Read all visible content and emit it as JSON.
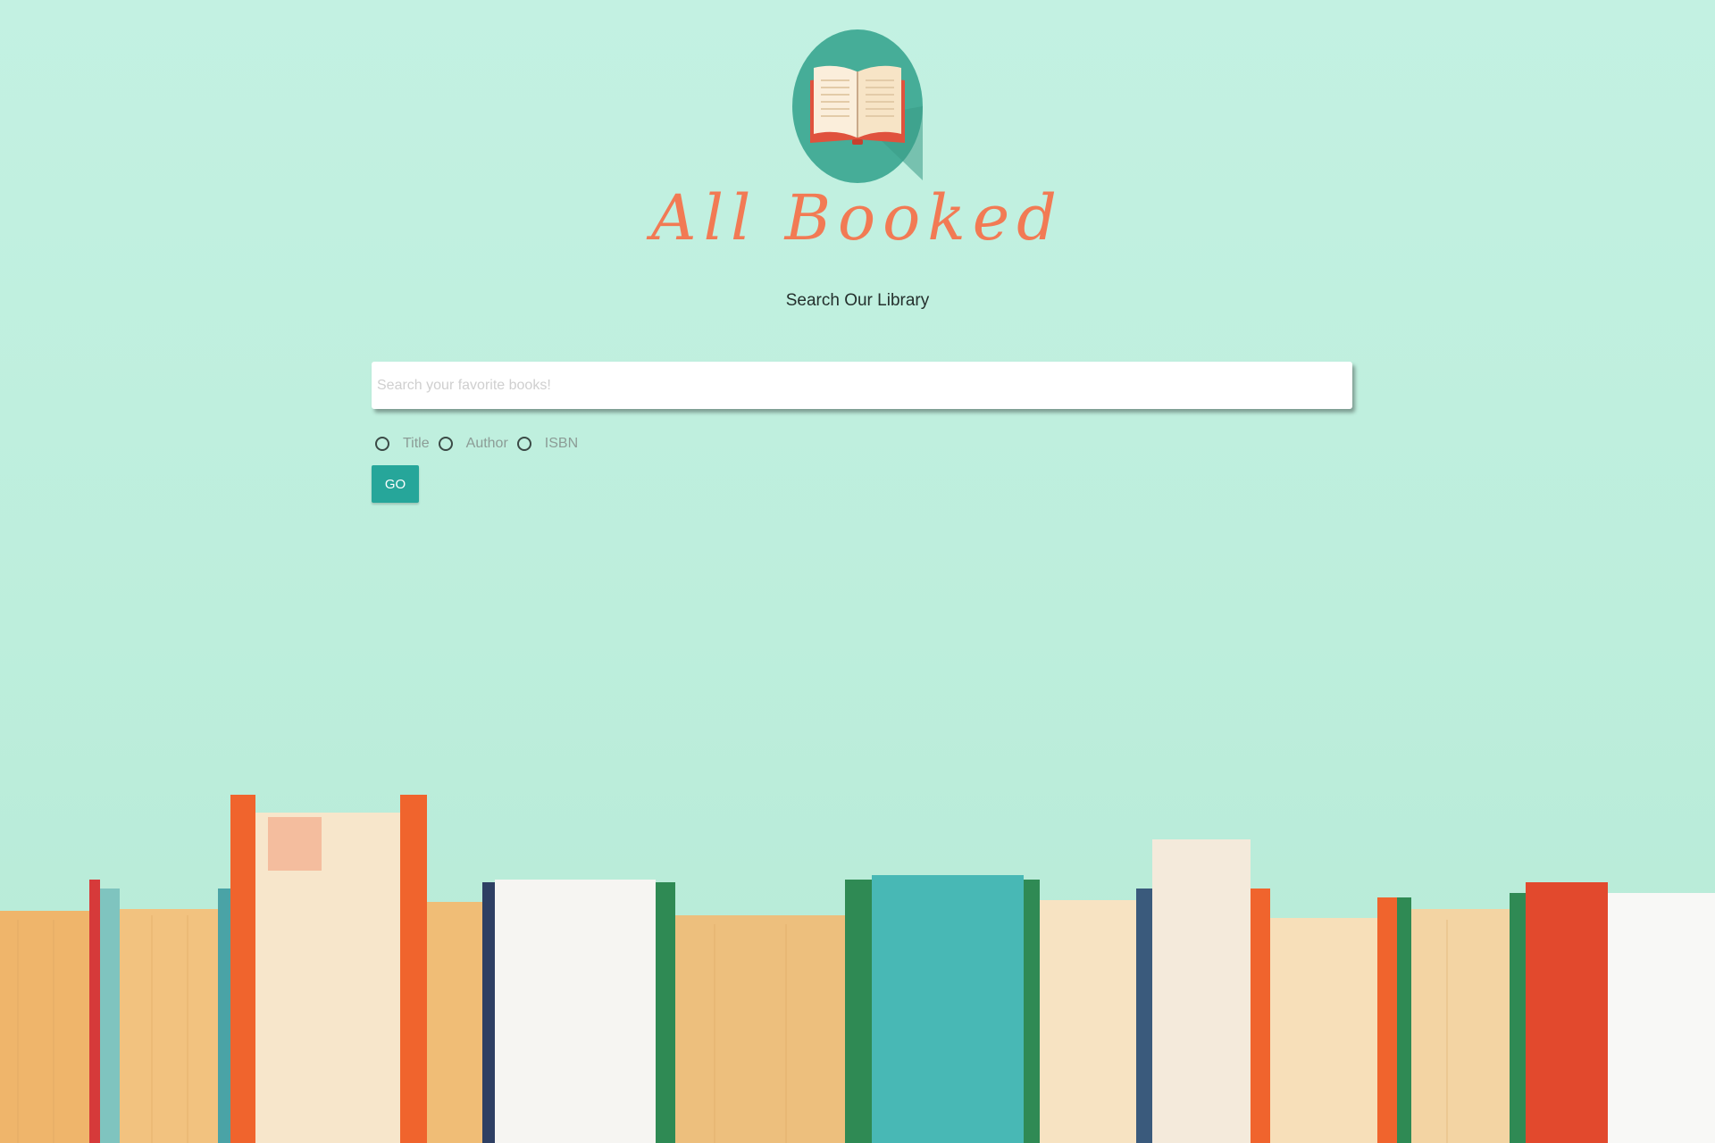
{
  "brand": {
    "logo_icon": "open-book-icon",
    "name": "All Booked"
  },
  "subtitle": "Search Our Library",
  "search": {
    "placeholder": "Search your favorite books!",
    "value": ""
  },
  "search_types": [
    {
      "label": "Title",
      "selected": false
    },
    {
      "label": "Author",
      "selected": false
    },
    {
      "label": "ISBN",
      "selected": false
    }
  ],
  "go_label": "GO",
  "colors": {
    "background": "#c3f1e2",
    "brand": "#f27a54",
    "logo_circle": "#46ad98",
    "button": "#26a69a"
  },
  "decor": {
    "background_image": "row-of-books"
  }
}
